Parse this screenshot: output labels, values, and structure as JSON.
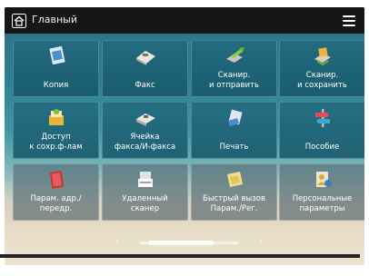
{
  "header": {
    "title": "Главный",
    "home_icon": "home-icon",
    "menu_icon": "hamburger-menu-icon"
  },
  "tiles": [
    {
      "label": "Копия",
      "icon": "copy-icon"
    },
    {
      "label": "Факс",
      "icon": "fax-icon"
    },
    {
      "label": "Сканир.\nи отправить",
      "icon": "scan-and-send-icon"
    },
    {
      "label": "Сканир.\nи сохранить",
      "icon": "scan-and-store-icon"
    },
    {
      "label": "Доступ\nк сохр.ф-лам",
      "icon": "access-stored-files-icon"
    },
    {
      "label": "Ячейка\nфакса/И-факса",
      "icon": "fax-inbox-icon"
    },
    {
      "label": "Печать",
      "icon": "print-icon"
    },
    {
      "label": "Пособие",
      "icon": "tutorial-signpost-icon"
    },
    {
      "label": "Парам. адр./\nпередр.",
      "icon": "address-book-icon"
    },
    {
      "label": "Удаленный\nсканер",
      "icon": "remote-scanner-icon"
    },
    {
      "label": "Быстрый вызов\nПарам./Рег.",
      "icon": "quick-settings-icon"
    },
    {
      "label": "Персональные\nпараметры",
      "icon": "personal-settings-icon"
    }
  ],
  "pager": {
    "prev_glyph": "‹",
    "next_glyph": "›"
  },
  "colors": {
    "topbar": "#161616",
    "tile": "#1f6a80"
  }
}
